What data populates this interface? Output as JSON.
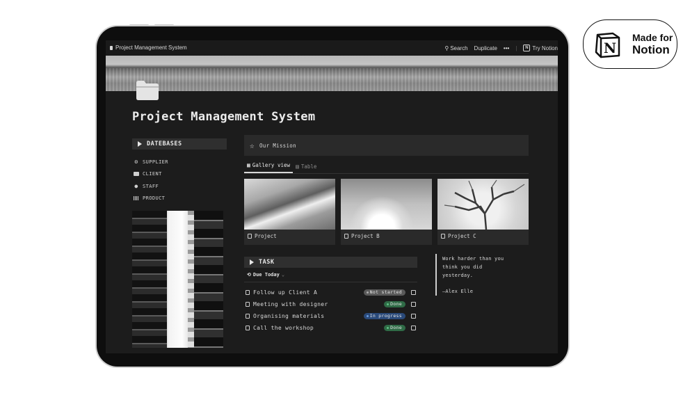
{
  "badge": {
    "line1": "Made for",
    "line2": "Notion"
  },
  "topbar": {
    "breadcrumb": "Project Management System",
    "search": "Search",
    "duplicate": "Duplicate",
    "more": "•••",
    "try_notion": "Try Notion"
  },
  "page": {
    "title": "Project Management System"
  },
  "databases": {
    "header": "DATEBASES",
    "items": [
      {
        "label": "SUPPLIER",
        "icon": "gear-icon"
      },
      {
        "label": "CLIENT",
        "icon": "briefcase-icon"
      },
      {
        "label": "STAFF",
        "icon": "person-icon"
      },
      {
        "label": "PRODUCT",
        "icon": "barcode-icon"
      }
    ]
  },
  "mission": {
    "label": "Our Mission"
  },
  "views": {
    "gallery": "Gallery view",
    "table": "Table"
  },
  "gallery": [
    {
      "title": "Project"
    },
    {
      "title": "Project B"
    },
    {
      "title": "Project C"
    }
  ],
  "task": {
    "header": "TASK",
    "filter": "Due Today",
    "items": [
      {
        "title": "Follow up Client A",
        "status": "Not started",
        "status_color": "#5a5a5a"
      },
      {
        "title": "Meeting with designer",
        "status": "Done",
        "status_color": "#2f6b46"
      },
      {
        "title": "Organising materials",
        "status": "In progress",
        "status_color": "#2a4a7a"
      },
      {
        "title": "Call the workshop",
        "status": "Done",
        "status_color": "#2f6b46"
      }
    ]
  },
  "quote": {
    "line1": "Work harder than you",
    "line2": "think you did",
    "line3": "yesterday.",
    "author": "—Alex Elle"
  }
}
